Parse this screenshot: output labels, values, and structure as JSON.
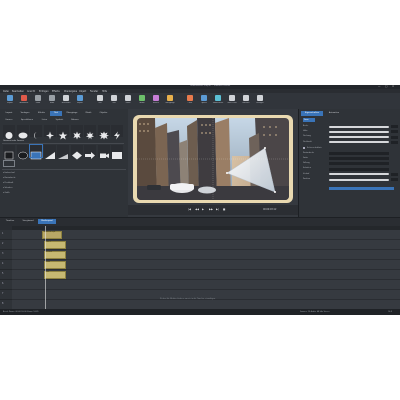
{
  "window": {
    "title": "Unbenanntes Projekt* - VideoPro Deluxe",
    "controls": [
      "—",
      "□",
      "✕"
    ]
  },
  "menubar": [
    "Datei",
    "Bearbeiten",
    "Ansicht",
    "Einfügen",
    "Effekte",
    "Wiedergabe",
    "Objekt",
    "Fenster",
    "Hilfe"
  ],
  "toolbar": {
    "buttons": [
      {
        "label": "Import",
        "icon": "import-icon"
      },
      {
        "label": "Aufnahme",
        "icon": "record-icon"
      },
      {
        "label": "Undo",
        "icon": "undo-icon"
      },
      {
        "label": "Redo",
        "icon": "redo-icon"
      },
      {
        "label": "Schneiden",
        "icon": "cut-icon"
      },
      {
        "label": "Export",
        "icon": "export-icon"
      },
      {
        "label": "Titel",
        "icon": "title-icon"
      },
      {
        "label": "Text",
        "icon": "text-icon"
      },
      {
        "label": "Zoom",
        "icon": "zoom-icon"
      },
      {
        "label": "Audio",
        "icon": "audio-icon"
      },
      {
        "label": "Effekte",
        "icon": "fx-icon"
      },
      {
        "label": "Übergänge",
        "icon": "transition-icon"
      },
      {
        "label": "Color",
        "icon": "color-icon"
      },
      {
        "label": "Speed",
        "icon": "speed-icon"
      },
      {
        "label": "Stabilisieren",
        "icon": "stabilize-icon"
      },
      {
        "label": "Intro/Outro",
        "icon": "intro-icon"
      },
      {
        "label": "Rahmen",
        "icon": "frame-icon"
      },
      {
        "label": "Vorlagen",
        "icon": "template-icon"
      }
    ]
  },
  "left_panel": {
    "tabs": [
      "Import",
      "Vorlagen",
      "Effekte",
      "Titel",
      "Übergänge",
      "Musik",
      "Objekte"
    ],
    "active_tab": "Titel",
    "subtabs": [
      "Formen",
      "Sprechblasen",
      "Linien",
      "Symbole",
      "Rahmen"
    ],
    "shapes_row": [
      {
        "label": "Kreis",
        "icon": "circle-icon"
      },
      {
        "label": "Ellipse",
        "icon": "ellipse-icon"
      },
      {
        "label": "Halbmond",
        "icon": "crescent-icon"
      },
      {
        "label": "Stern 4",
        "icon": "star4-icon"
      },
      {
        "label": "Stern 5",
        "icon": "star5-icon"
      },
      {
        "label": "Stern 6",
        "icon": "star6-icon"
      },
      {
        "label": "Stern 7",
        "icon": "star7-icon"
      },
      {
        "label": "Zacken",
        "icon": "burst-icon"
      },
      {
        "label": "Blitz",
        "icon": "bolt-icon"
      }
    ],
    "section_label": "Geometrische Formen",
    "geo_row": [
      {
        "label": "Quadrat",
        "icon": "square-icon"
      },
      {
        "label": "Oval",
        "icon": "oval-icon"
      },
      {
        "label": "Rechteck",
        "icon": "rect-icon"
      },
      {
        "label": "Dreieck",
        "icon": "triangle-icon"
      },
      {
        "label": "Rampe",
        "icon": "ramp-icon"
      },
      {
        "label": "Raute",
        "icon": "diamond-icon"
      },
      {
        "label": "Pfeil",
        "icon": "arrow-icon"
      },
      {
        "label": "Kamera",
        "icon": "camera-icon"
      },
      {
        "label": "Form",
        "icon": "shape-icon"
      }
    ],
    "props": [
      "Farbverlauf",
      "Konturbreite",
      "Deckkraft",
      "Schatten",
      "Größe"
    ]
  },
  "preview": {
    "transport": [
      "|◀",
      "◀◀",
      "▶",
      "▶▶",
      "▶|",
      "■"
    ],
    "timecode": "00:00:03:12"
  },
  "right_panel": {
    "tabs": [
      "Eigenschaften",
      "Animation"
    ],
    "active_tab": "Eigenschaften",
    "section": "Form",
    "rows": [
      "Breite",
      "Höhe",
      "Drehung",
      "Deckkraft",
      "Konturbreite",
      "Farbe",
      "Füllung",
      "Schatten",
      "Verlauf",
      "Position"
    ],
    "checkbox_label": "Seitenverhältnis",
    "color_swatch": "#3a74b8"
  },
  "timeline": {
    "tabs": [
      "Timeline",
      "Storyboard",
      "Medienpool"
    ],
    "active_tab": "Medienpool",
    "tracks": [
      "1",
      "2",
      "3",
      "4",
      "5",
      "6",
      "7",
      "8"
    ],
    "clips": [
      {
        "track": 0,
        "label": "Stadtbild.mp4"
      },
      {
        "track": 1,
        "label": "Titel 1"
      },
      {
        "track": 2,
        "label": "Dreieck"
      },
      {
        "track": 3,
        "label": "Form"
      },
      {
        "track": 4,
        "label": "Text"
      }
    ],
    "drop_hint": "Ziehen Sie Medien hierher, um sie in die Timeline einzufügen."
  },
  "status": {
    "left": "Bereit  Dauer: 00:00:10:00  Zoom: 100%",
    "right": "Frames: 25  Audio: 48 kHz  Stereo",
    "corner": "16:9"
  },
  "colors": {
    "accent": "#3a74b8",
    "clip": "#c6b872",
    "background": "#2c3036"
  }
}
